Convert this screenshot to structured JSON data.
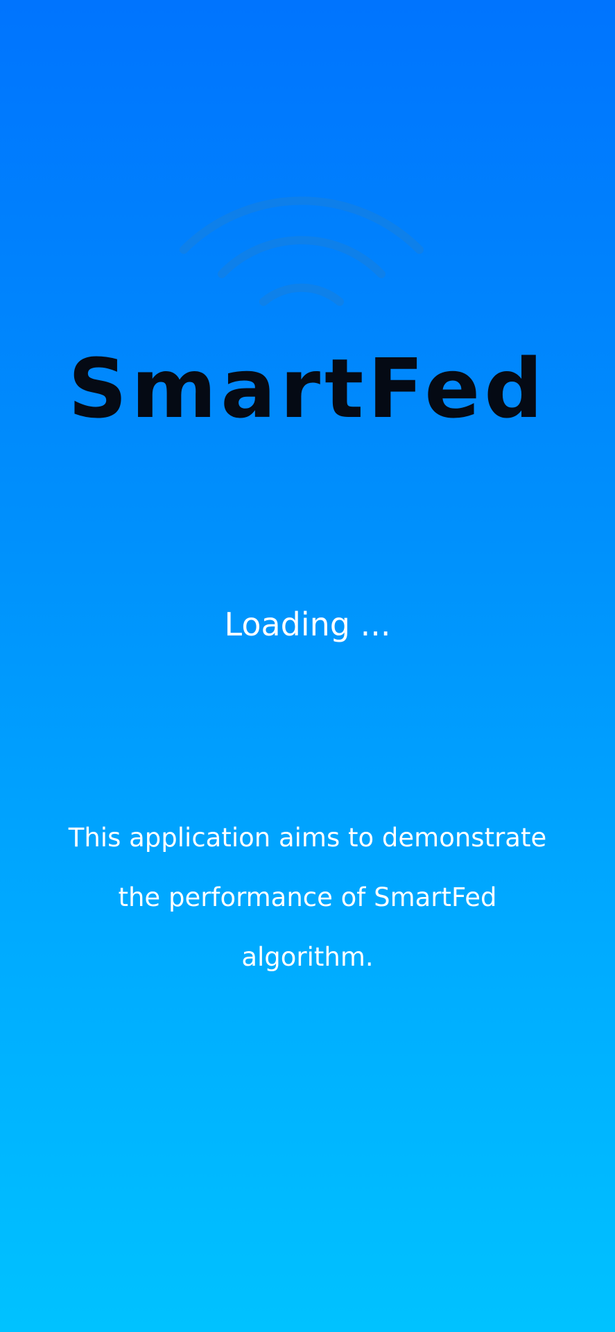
{
  "splash": {
    "logo_icon": "wifi-signal-icon",
    "title": "SmartFed",
    "loading_text": "Loading ...",
    "description": "This application aims to demonstrate the performance of SmartFed algorithm."
  },
  "colors": {
    "background_top": "#0074fe",
    "background_bottom": "#00c2ff",
    "title": "#050a14",
    "text": "#ffffff",
    "icon": "#1a7fdb"
  }
}
